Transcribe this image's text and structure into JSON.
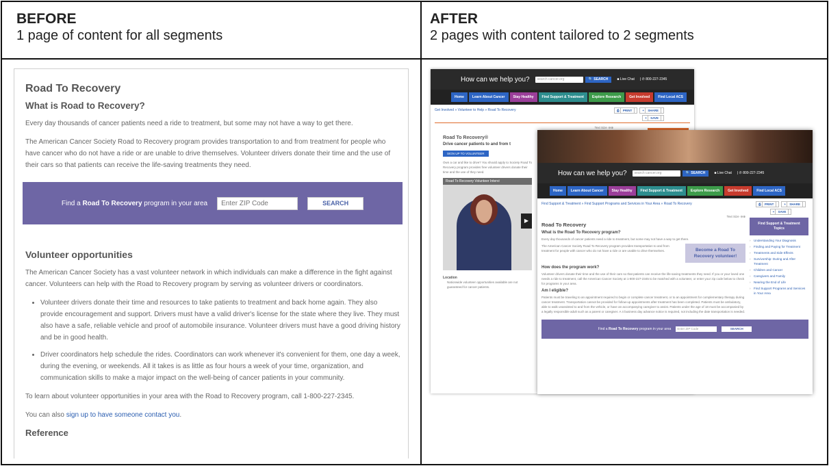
{
  "table": {
    "before_title": "BEFORE",
    "before_subtitle": "1 page of content for all segments",
    "after_title": "AFTER",
    "after_subtitle": "2 pages with content tailored to 2 segments"
  },
  "before_page": {
    "title": "Road To Recovery",
    "subtitle": "What is Road to Recovery?",
    "p1": "Every day thousands of cancer patients need a ride to treatment, but some may not have a way to get there.",
    "p2": "The American Cancer Society Road to Recovery program provides transportation to and from treatment for people who have cancer who do not have a ride or are unable to drive themselves. Volunteer drivers donate their time and the use of their cars so that patients can receive the life-saving treatments they need.",
    "find_prefix": "Find a ",
    "find_bold": "Road To Recovery",
    "find_suffix": " program in your area",
    "zip_placeholder": "Enter ZIP Code",
    "search_label": "SEARCH",
    "volunteer_title": "Volunteer opportunities",
    "p3": "The American Cancer Society has a vast volunteer network in which individuals can make a difference in the fight against cancer. Volunteers can help with the Road to Recovery program by serving as volunteer drivers or coordinators.",
    "bullet1": "Volunteer drivers donate their time and resources to take patients to treatment and back home again. They also provide encouragement and support. Drivers must have a valid driver's license for the state where they live. They must also have a safe, reliable vehicle and proof of automobile insurance. Volunteer drivers must have a good driving history and be in good health.",
    "bullet2": "Driver coordinators help schedule the rides. Coordinators can work whenever it's convenient for them, one day a week, during the evening, or weekends. All it takes is as little as four hours a week of your time, organization, and communication skills to make a major impact on the well-being of cancer patients in your community.",
    "p4": "To learn about volunteer opportunities in your area with the Road to Recovery program, call 1-800-227-2345.",
    "p5_prefix": "You can also ",
    "p5_link": "sign up to have someone contact you",
    "p5_suffix": ".",
    "reference": "Reference"
  },
  "after_common": {
    "help_question": "How can we help you?",
    "search_placeholder": "search cancer.org",
    "search_btn": "SEARCH",
    "live_chat": "Live Chat",
    "phone": "800-227-2345",
    "nav": [
      "Home",
      "Learn About Cancer",
      "Stay Healthy",
      "Find Support & Treatment",
      "Explore Research",
      "Get Involved",
      "Find Local ACS"
    ],
    "print": "PRINT",
    "share": "SHARE",
    "save": "SAVE",
    "text_size": "Text Size"
  },
  "after_shot1": {
    "breadcrumb": "Get Involved » Volunteer to Help » Road To Recovery",
    "title": "Road To Recovery®",
    "subtitle": "Drive cancer patients to and from t",
    "signup": "SIGN UP TO VOLUNTEER",
    "intro": "Own a car and like to drive? You should apply to Society Road To Recovery program provides free volunteer drivers donate their time and the use of they need.",
    "video_title": "Road To Recovery Volunteer Intervi",
    "location": "Location",
    "location_note": "Nationwide volunteer opportunities available are not guaranteed for cancer patients."
  },
  "after_shot2": {
    "breadcrumb": "Find Support & Treatment » Find Support Programs and Services in Your Area » Road To Recovery",
    "h1": "Road To Recovery",
    "h2_what": "What is the Road To Recovery program?",
    "p1": "Every day thousands of cancer patients need a ride to treatment, but some may not have a way to get there.",
    "p2": "The American Cancer Society Road To Recovery program provides transportation to and from treatment for people with cancer who do not have a ride or are unable to drive themselves.",
    "callout": "Become a Road To Recovery volunteer!",
    "h2_how": "How does the program work?",
    "p3": "Volunteer drivers donate their time and the use of their cars so that patients can receive the life-saving treatments they need. If you or your loved one needs a ride to treatment, call the American Cancer Society at 1-800-227-2345 to be matched with a volunteer, or enter your zip code below to check for programs in your area.",
    "h2_eligible": "Am I eligible?",
    "p4": "Patients must be traveling to an appointment required to begin or complete cancer treatment, or to an appointment for complementary therapy during cancer treatment. Transportation cannot be provided for follow-up appointments after treatment has been completed. Patients must be ambulatory, able to walk unassisted to and from the vehicle, or have an accompanying caregiver to assist. Patients under the age of 18 must be accompanied by a legally responsible adult such as a parent or caregiver. A 4 business day advance notice is required, not including the date transportation is needed.",
    "sidebar_title": "Find Support & Treatment Topics",
    "sidebar_items": [
      "Understanding Your Diagnosis",
      "Finding and Paying for Treatment",
      "Treatments and Side Effects",
      "Survivorship: During and After Treatment",
      "Children and Cancer",
      "Caregivers and Family",
      "Nearing the End of Life",
      "Find Support Programs and Services in Your Area"
    ],
    "find_prefix": "Find a ",
    "find_bold": "Road To Recovery",
    "find_suffix": " program in your area",
    "zip": "Enter ZIP Code",
    "search": "SEARCH"
  }
}
